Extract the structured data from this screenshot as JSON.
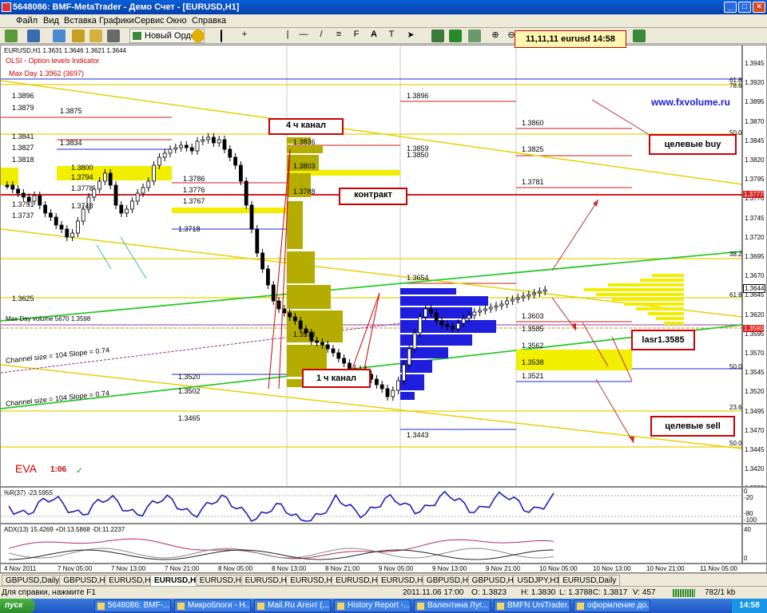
{
  "window": {
    "title": "5648086: BMF-MetaTrader - Демо Счет - [EURUSD,H1]"
  },
  "menu": [
    "Файл",
    "Вид",
    "Вставка",
    "Графики",
    "Сервис",
    "Окно",
    "Справка"
  ],
  "toolbar": {
    "new_order": "Новый Ордер"
  },
  "chart": {
    "header": "EURUSD,H1  1.3631 1.3646 1.3621 1.3644",
    "indicator_line1": "OLSI - Option levels Indicator",
    "indicator_line2": "Max Day 1.3962 (3697)",
    "brand": "www.fxvolume.ru",
    "top_note": "11,11,11 eurusd 14:58",
    "eva_label": "EVA",
    "eva_time": "1:06",
    "callouts": {
      "channel4h": "4 ч канал",
      "contract": "контракт",
      "targets_buy": "целевые buy",
      "channel1h": "1 ч канал",
      "last": "lasr1.3585",
      "targets_sell": "целевые sell"
    },
    "channel_labels": [
      "Channel size = 104 Slope = 0.74",
      "Channel size = 104 Slope = 0.74",
      "Max Day volume 5670 1.3598"
    ],
    "level_labels": [
      "1.3896",
      "1.3879",
      "1.3875",
      "1.3841",
      "1.3827",
      "1.3834",
      "1.3818",
      "1.3800",
      "1.3794",
      "1.3788",
      "1.3786",
      "1.3776",
      "1.3778",
      "1.3767",
      "1.3748",
      "1.3751",
      "1.3737",
      "1.3718",
      "1.3625",
      "1.3578",
      "1.3520",
      "1.3502",
      "1.3465",
      "1.3896",
      "1.3860",
      "1.3825",
      "1.3781",
      "1.3654",
      "1.3603",
      "1.3585",
      "1.3562",
      "1.3538",
      "1.3521",
      "1.3443",
      "1.3836",
      "1.3803",
      "1.3788",
      "1.3859",
      "1.3850"
    ],
    "price_axis": [
      "1.3945",
      "1.3920",
      "1.3895",
      "1.3870",
      "1.3845",
      "1.3820",
      "1.3795",
      "1.3770",
      "1.3745",
      "1.3720",
      "1.3695",
      "1.3670",
      "1.3645",
      "1.3620",
      "1.3595",
      "1.3570",
      "1.3545",
      "1.3520",
      "1.3495",
      "1.3470",
      "1.3445",
      "1.3420",
      "1.3395"
    ],
    "fib_labels": [
      "61.8",
      "78.6",
      "50.0",
      "38.2",
      "61.8",
      "50.0",
      "23.6",
      "50.0"
    ],
    "current_price": "1.3644",
    "contract_price": "1.3777",
    "fib_price": "1.3590"
  },
  "indicators": {
    "wpr": "%R(37) -23.5955",
    "adx": "ADX(13) 15.4269 +DI:13.5868 -DI:11.2237",
    "wpr_levels": [
      "0",
      "-20",
      "-80",
      "-100"
    ],
    "adx_levels": [
      "40",
      "0"
    ]
  },
  "time_axis": [
    "4 Nov 2011",
    "7 Nov 05:00",
    "7 Nov 13:00",
    "7 Nov 21:00",
    "8 Nov 05:00",
    "8 Nov 13:00",
    "8 Nov 21:00",
    "9 Nov 05:00",
    "9 Nov 13:00",
    "9 Nov 21:00",
    "10 Nov 05:00",
    "10 Nov 13:00",
    "10 Nov 21:00",
    "11 Nov 05:00"
  ],
  "tabs": [
    "GBPUSD,Daily",
    "GBPUSD,H1",
    "EURUSD,H1",
    "EURUSD,H1",
    "EURUSD,H1",
    "EURUSD,H1",
    "EURUSD,H1",
    "EURUSD,H1",
    "EURUSD,H1",
    "GBPUSD,H1",
    "GBPUSD,H1",
    "USDJPY,H1",
    "EURUSD,Daily"
  ],
  "active_tab": 3,
  "status": {
    "help": "Для справки, нажмите F1",
    "datetime": "2011.11.06 17:00",
    "open": "O: 1.3823",
    "high": "H: 1.3830",
    "low": "L: 1.3788",
    "close": "C: 1.3817",
    "volume": "V: 457",
    "traffic": "782/1 kb"
  },
  "taskbar": {
    "start": "пуск",
    "tasks": [
      "5648086: BMF-...",
      "Микроблоги - Н...",
      "Mail.Ru Агент (...",
      "History Report -...",
      "Валентина Луг...",
      "BMFN UniTrader...",
      "оформление до..."
    ],
    "clock": "14:58"
  }
}
